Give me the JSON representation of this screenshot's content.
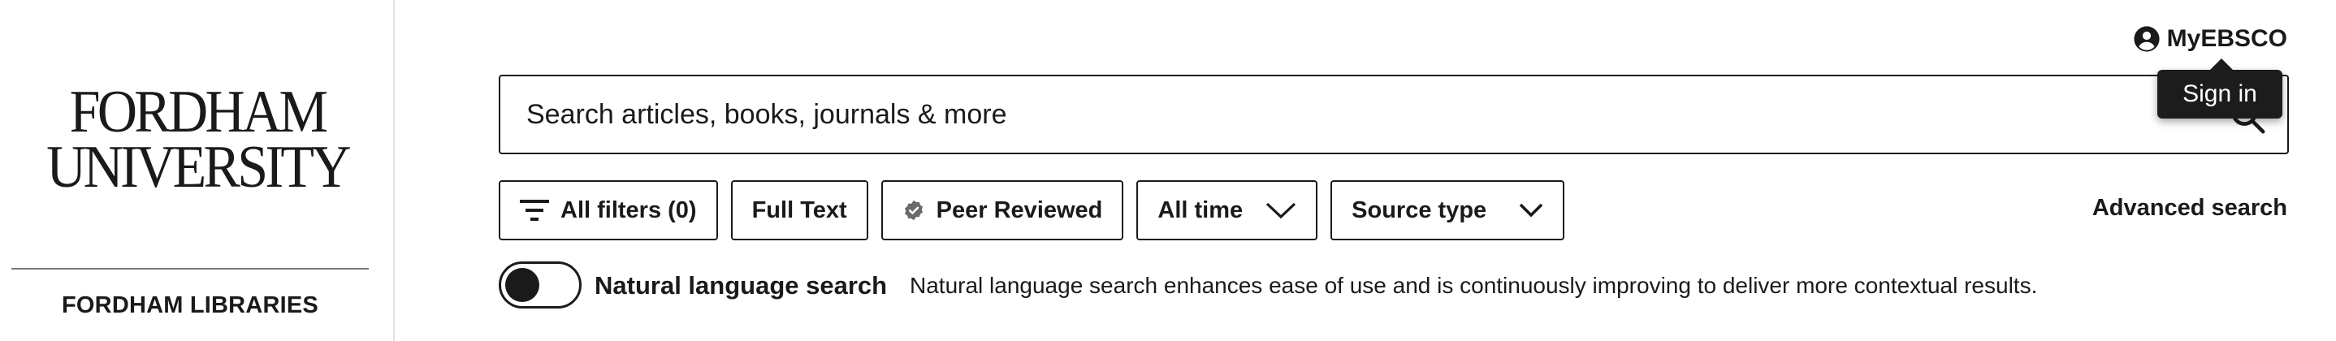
{
  "sidebar": {
    "logo_line1": "FORDHAM",
    "logo_line2": "UNIVERSITY",
    "library_label": "FORDHAM LIBRARIES"
  },
  "header": {
    "account_label": "MyEBSCO",
    "account_icon": "user-circle-icon",
    "tooltip": "Sign in"
  },
  "search": {
    "placeholder": "Search articles, books, journals & more",
    "value": ""
  },
  "filters": {
    "all_filters": "All filters (0)",
    "full_text": "Full Text",
    "peer_reviewed": "Peer Reviewed",
    "time": "All time",
    "source_type": "Source type"
  },
  "advanced_search": "Advanced search",
  "natural_language": {
    "label": "Natural language search",
    "description": "Natural language search enhances ease of use and is continuously improving to deliver more contextual results.",
    "enabled": false
  },
  "colors": {
    "text": "#1a1a1a",
    "tooltip_bg": "#1c1c1c",
    "divider": "#e2e2e2"
  }
}
